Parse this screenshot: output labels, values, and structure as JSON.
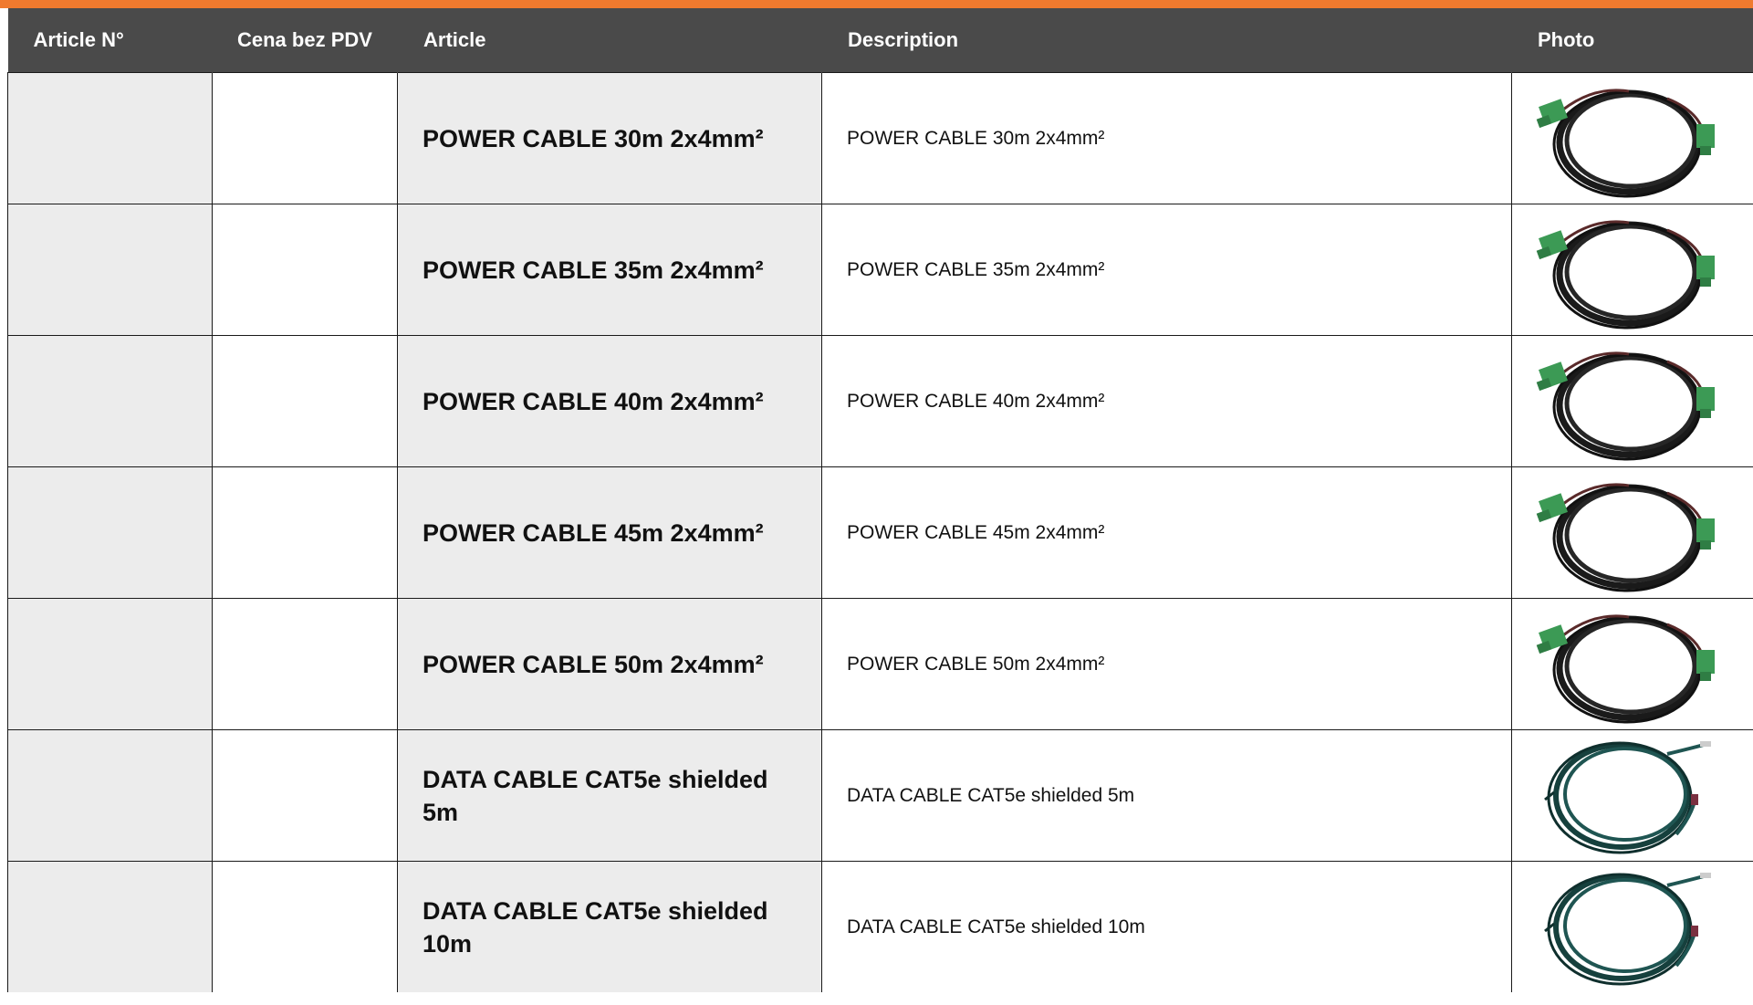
{
  "header": {
    "article_no": "Article N°",
    "price": "Cena bez PDV",
    "article": "Article",
    "description": "Description",
    "photo": "Photo"
  },
  "rows": [
    {
      "article_no": "",
      "price": "",
      "article": "POWER CABLE 30m 2x4mm²",
      "description": "POWER CABLE 30m 2x4mm²",
      "photo_icon": "power-cable-photo"
    },
    {
      "article_no": "",
      "price": "",
      "article": "POWER CABLE 35m 2x4mm²",
      "description": "POWER CABLE 35m 2x4mm²",
      "photo_icon": "power-cable-photo"
    },
    {
      "article_no": "",
      "price": "",
      "article": "POWER CABLE 40m 2x4mm²",
      "description": "POWER CABLE 40m 2x4mm²",
      "photo_icon": "power-cable-photo"
    },
    {
      "article_no": "",
      "price": "",
      "article": "POWER CABLE 45m 2x4mm²",
      "description": "POWER CABLE 45m 2x4mm²",
      "photo_icon": "power-cable-photo"
    },
    {
      "article_no": "",
      "price": "",
      "article": "POWER CABLE 50m 2x4mm²",
      "description": "POWER CABLE 50m 2x4mm²",
      "photo_icon": "power-cable-photo"
    },
    {
      "article_no": "",
      "price": "",
      "article": "DATA CABLE CAT5e shielded 5m",
      "description": "DATA CABLE CAT5e shielded 5m",
      "photo_icon": "data-cable-photo"
    },
    {
      "article_no": "",
      "price": "",
      "article": "DATA CABLE CAT5e shielded 10m",
      "description": "DATA CABLE CAT5e shielded 10m",
      "photo_icon": "data-cable-photo"
    }
  ],
  "colors": {
    "accent_bar": "#f07a2e",
    "header_bg": "#4a4a4a",
    "shaded_cell": "#ececec"
  }
}
